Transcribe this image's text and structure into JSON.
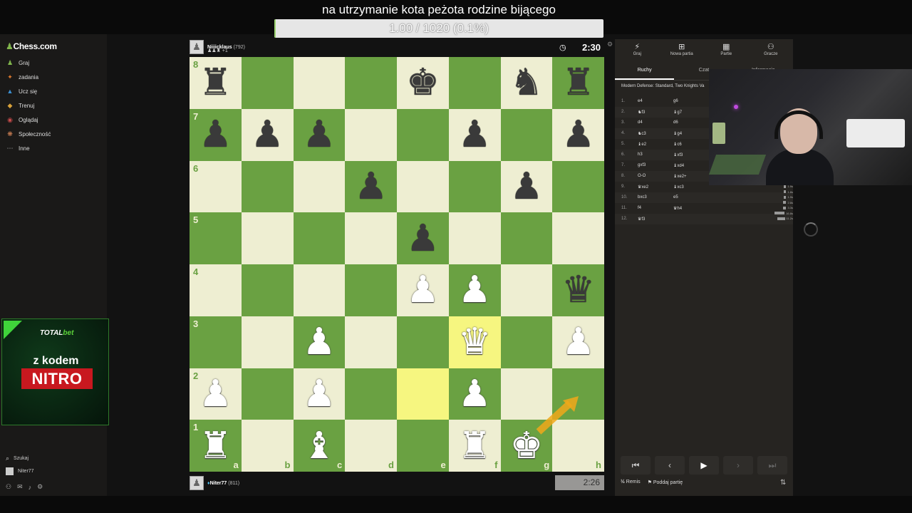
{
  "stream": {
    "goal_title": "na utrzymanie kota pеżota rodzine bijącego",
    "goal_progress_text": "1.00 / 1020 (0.1%)",
    "goal_progress_fraction": 0.001
  },
  "sidebar": {
    "logo_text": "Chess.com",
    "items": [
      {
        "label": "Graj",
        "icon": "play-icon",
        "color": "#81b64c"
      },
      {
        "label": "zadania",
        "icon": "puzzle-icon",
        "color": "#e07a2e"
      },
      {
        "label": "Ucz się",
        "icon": "learn-icon",
        "color": "#3b8ed0"
      },
      {
        "label": "Trenuj",
        "icon": "train-icon",
        "color": "#d9a23a"
      },
      {
        "label": "Oglądaj",
        "icon": "watch-icon",
        "color": "#c44a4a"
      },
      {
        "label": "Społeczność",
        "icon": "community-icon",
        "color": "#e08a5a"
      },
      {
        "label": "Inne",
        "icon": "more-icon",
        "color": "#aaaaaa"
      }
    ],
    "search_label": "Szukaj",
    "user_label": "Niter77"
  },
  "promo": {
    "brand_total": "TOTAL",
    "brand_bet": "bet",
    "line1": "z kodem",
    "line2": "NITRO"
  },
  "game": {
    "top_player": {
      "name": "Niiiicklaus",
      "rating": "(792)",
      "captured": "+1"
    },
    "bottom_player": {
      "name": "Niter77",
      "rating": "(811)"
    },
    "top_clock": "2:30",
    "bottom_clock": "2:26",
    "files": [
      "a",
      "b",
      "c",
      "d",
      "e",
      "f",
      "g",
      "h"
    ],
    "ranks": [
      "8",
      "7",
      "6",
      "5",
      "4",
      "3",
      "2",
      "1"
    ],
    "position": [
      [
        "r",
        "",
        "",
        "",
        "k",
        "",
        "n",
        "r"
      ],
      [
        "p",
        "p",
        "p",
        "",
        "",
        "p",
        "",
        "p"
      ],
      [
        "",
        "",
        "",
        "p",
        "",
        "",
        "p",
        ""
      ],
      [
        "",
        "",
        "",
        "",
        "p",
        "",
        "",
        ""
      ],
      [
        "",
        "",
        "",
        "",
        "P",
        "P",
        "",
        "q"
      ],
      [
        "",
        "",
        "P",
        "",
        "",
        "Q",
        "",
        "P"
      ],
      [
        "P",
        "",
        "P",
        "",
        "",
        "P",
        "",
        ""
      ],
      [
        "R",
        "",
        "B",
        "",
        "",
        "R",
        "K",
        ""
      ]
    ],
    "highlighted_squares": [
      "e2",
      "f3"
    ]
  },
  "panel": {
    "tabs": [
      {
        "label": "Graj",
        "icon": "play-icon"
      },
      {
        "label": "Nowa partia",
        "icon": "plus-icon"
      },
      {
        "label": "Partie",
        "icon": "board-icon"
      },
      {
        "label": "Gracze",
        "icon": "players-icon"
      }
    ],
    "subtabs": [
      "Ruchy",
      "Czat",
      "Informacje"
    ],
    "opening": "Modern Defense: Standard, Two Knights Va",
    "moves": [
      {
        "no": "1.",
        "w": "e4",
        "b": "g6"
      },
      {
        "no": "2.",
        "w": "♞f3",
        "b": "♝g7"
      },
      {
        "no": "3.",
        "w": "d4",
        "b": "d6"
      },
      {
        "no": "4.",
        "w": "♞c3",
        "b": "♝g4"
      },
      {
        "no": "5.",
        "w": "♝e2",
        "b": "♝c6"
      },
      {
        "no": "6.",
        "w": "h3",
        "b": "♝xf3"
      },
      {
        "no": "7.",
        "w": "gxf3",
        "b": "♝xd4"
      },
      {
        "no": "8.",
        "w": "O-O",
        "b": "♝xe2+"
      },
      {
        "no": "9.",
        "w": "♛xe2",
        "b": "♝xc3"
      },
      {
        "no": "10.",
        "w": "bxc3",
        "b": "e5"
      },
      {
        "no": "11.",
        "w": "f4",
        "b": "♛h4"
      },
      {
        "no": "12.",
        "w": "♛f3",
        "b": ""
      }
    ],
    "time_marks": [
      "1.9s",
      "1.8s",
      "1.9s",
      "2.8s",
      "3.3s",
      "16.8s",
      "11.2s"
    ],
    "nav_buttons": [
      "⏮",
      "‹",
      "▶",
      "›",
      "⏭"
    ],
    "draw_label": "Remis",
    "resign_label": "Poddaj partię"
  }
}
